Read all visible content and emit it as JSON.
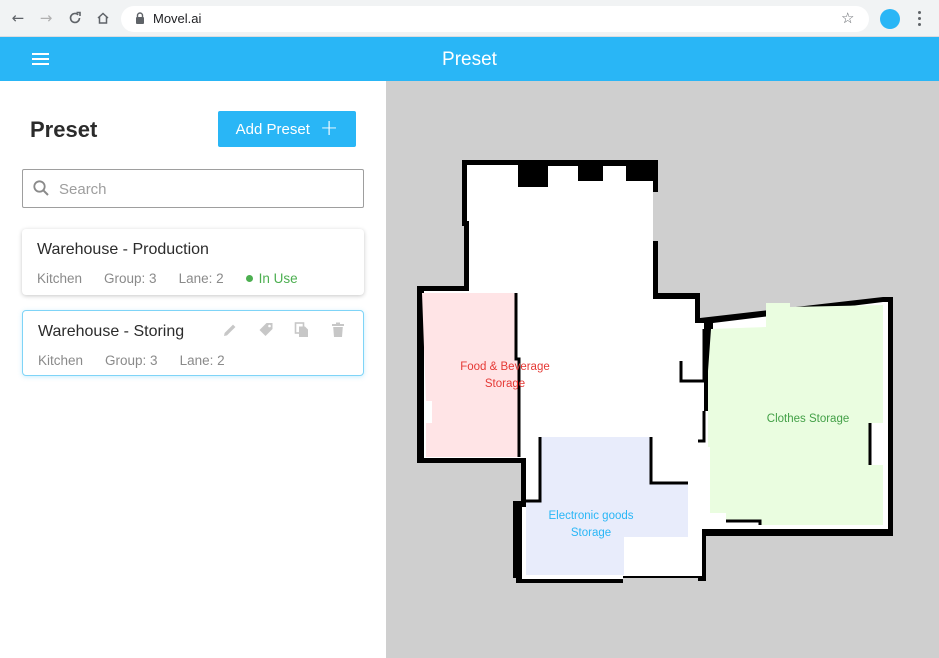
{
  "browser": {
    "url": "Movel.ai"
  },
  "appbar": {
    "title": "Preset"
  },
  "panel": {
    "title": "Preset",
    "add_button_label": "Add Preset",
    "search_placeholder": "Search"
  },
  "presets": [
    {
      "name": "Warehouse - Production",
      "location": "Kitchen",
      "group": "Group: 3",
      "lane": "Lane: 2",
      "status": "In Use"
    },
    {
      "name": "Warehouse - Storing",
      "location": "Kitchen",
      "group": "Group: 3",
      "lane": "Lane: 2"
    }
  ],
  "map": {
    "zones": [
      {
        "label_line1": "Food & Beverage",
        "label_line2": "Storage",
        "color": "#e53935"
      },
      {
        "label_line1": "Electronic goods",
        "label_line2": "Storage",
        "color": "#29b6f6"
      },
      {
        "label_line1": "Clothes Storage",
        "label_line2": "",
        "color": "#43a047"
      }
    ]
  },
  "colors": {
    "accent": "#29b6f6",
    "status_in_use": "#4caf50"
  }
}
